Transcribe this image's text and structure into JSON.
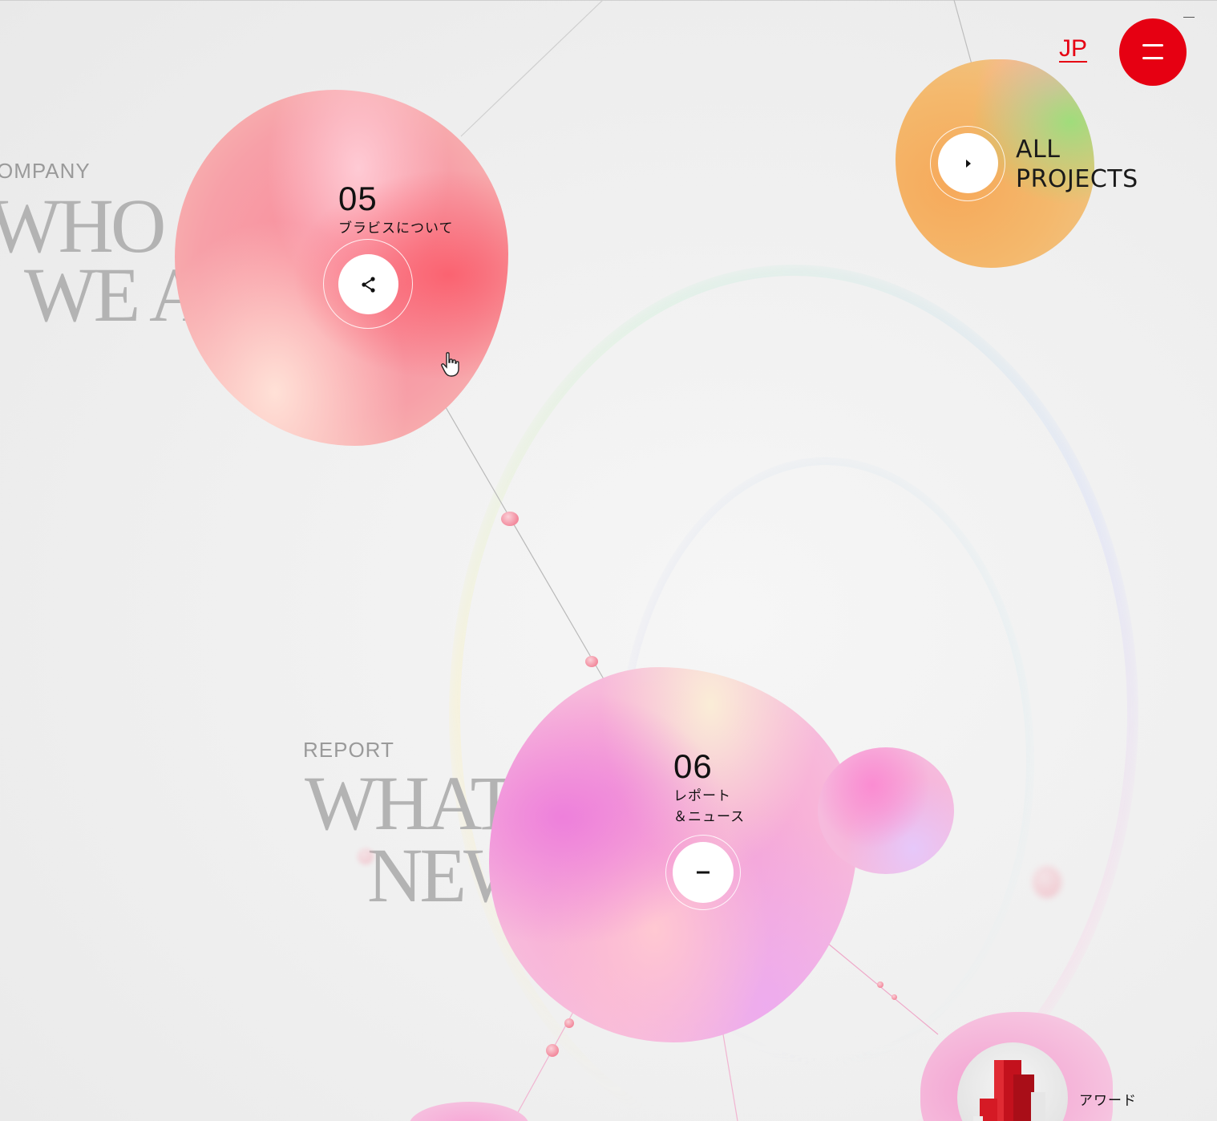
{
  "header": {
    "lang_label": "JP",
    "menu_icon": "hamburger-icon",
    "accent": "#e60012"
  },
  "sections": {
    "company": {
      "small": "OMPANY",
      "big_line1": "WHO",
      "big_line2": "WE A"
    },
    "report": {
      "small": "REPORT",
      "big_line1": "WHAT",
      "big_line2": "NEW"
    }
  },
  "bubbles": {
    "b05": {
      "number": "05",
      "label": "ブラビスについて",
      "icon": "share-icon"
    },
    "b06": {
      "number": "06",
      "label_line1": "レポート",
      "label_line2": "＆ニュース",
      "icon": "minus-icon"
    },
    "projects": {
      "line1": "ALL",
      "line2": "PROJECTS",
      "icon": "chevron-right-icon"
    },
    "award": {
      "label": "アワード"
    }
  }
}
